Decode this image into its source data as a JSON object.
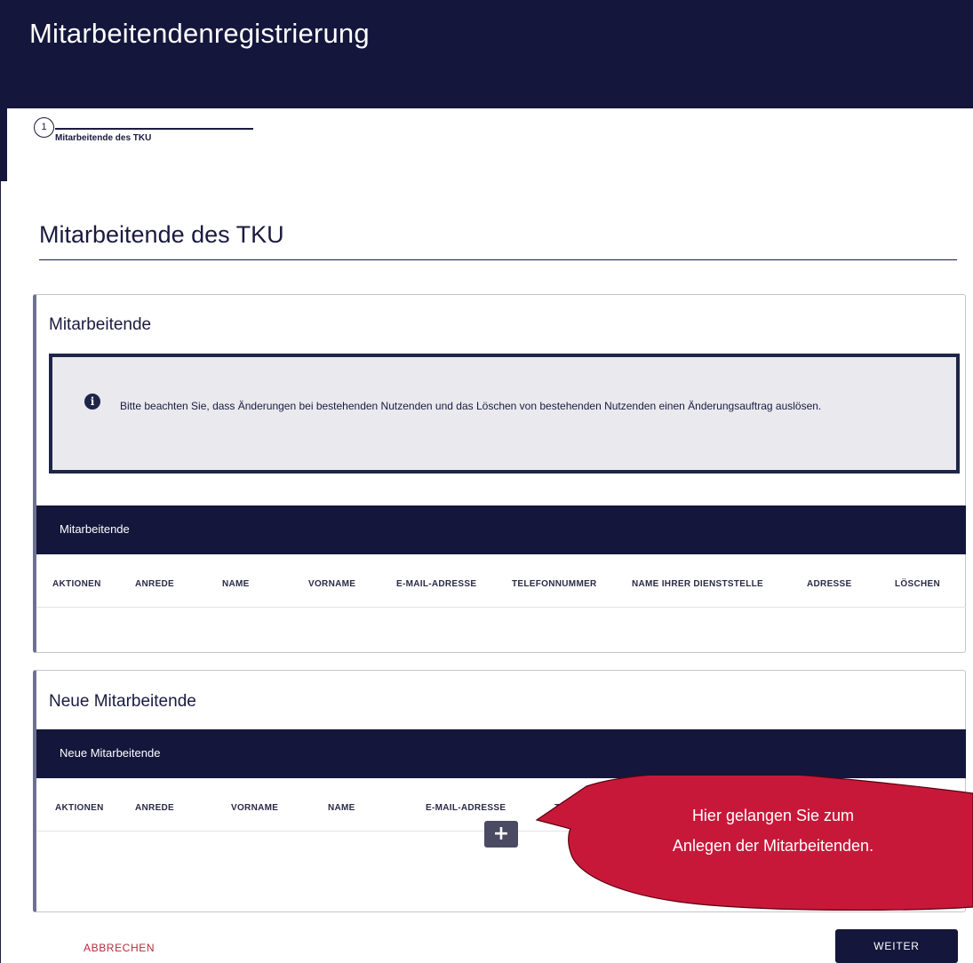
{
  "header": {
    "title": "Mitarbeitendenregistrierung"
  },
  "stepper": {
    "step_number": "1",
    "step_label": "Mitarbeitende des TKU"
  },
  "page": {
    "title": "Mitarbeitende des TKU"
  },
  "existing": {
    "card_title": "Mitarbeitende",
    "info_text": "Bitte beachten Sie, dass Änderungen bei bestehenden Nutzenden und das Löschen von bestehenden Nutzenden einen Änderungsauftrag auslösen.",
    "table_title": "Mitarbeitende",
    "columns": [
      "AKTIONEN",
      "ANREDE",
      "NAME",
      "VORNAME",
      "E-MAIL-ADRESSE",
      "TELEFONNUMMER",
      "NAME IHRER DIENSTSTELLE",
      "ADRESSE",
      "LÖSCHEN"
    ]
  },
  "new": {
    "card_title": "Neue Mitarbeitende",
    "table_title": "Neue Mitarbeitende",
    "columns": [
      "AKTIONEN",
      "ANREDE",
      "VORNAME",
      "NAME",
      "E-MAIL-ADRESSE",
      "TELEFO"
    ],
    "add_label": "+"
  },
  "callout": {
    "line1": "Hier gelangen Sie zum",
    "line2": "Anlegen der Mitarbeitenden."
  },
  "footer": {
    "cancel_label": "ABBRECHEN",
    "next_label": "WEITER"
  },
  "colors": {
    "navy": "#14163c",
    "callout_red": "#c8183a",
    "cancel_red": "#b22d3c"
  }
}
